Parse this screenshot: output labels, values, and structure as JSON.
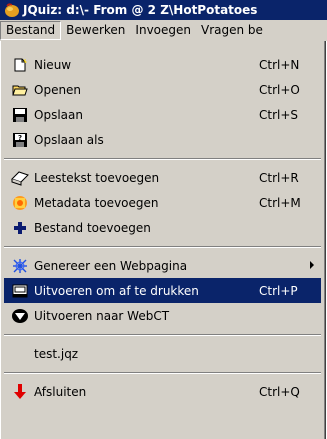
{
  "window": {
    "title": "JQuiz: d:\\- From @ 2 Z\\HotPotatoes"
  },
  "menubar": {
    "items": [
      {
        "label": "Bestand"
      },
      {
        "label": "Bewerken"
      },
      {
        "label": "Invoegen"
      },
      {
        "label": "Vragen be"
      }
    ]
  },
  "dropdown": {
    "items": [
      {
        "label": "Nieuw",
        "shortcut": "Ctrl+N",
        "icon": "new-file-icon"
      },
      {
        "label": "Openen",
        "shortcut": "Ctrl+O",
        "icon": "open-folder-icon"
      },
      {
        "label": "Opslaan",
        "shortcut": "Ctrl+S",
        "icon": "save-disk-icon"
      },
      {
        "label": "Opslaan als",
        "shortcut": "",
        "icon": "save-as-icon"
      },
      {
        "label": "Leestekst toevoegen",
        "shortcut": "Ctrl+R",
        "icon": "reading-text-icon"
      },
      {
        "label": "Metadata toevoegen",
        "shortcut": "Ctrl+M",
        "icon": "metadata-icon"
      },
      {
        "label": "Bestand toevoegen",
        "shortcut": "",
        "icon": "add-file-icon"
      },
      {
        "label": "Genereer een Webpagina",
        "shortcut": "",
        "icon": "web-page-icon"
      },
      {
        "label": "Uitvoeren om af te drukken",
        "shortcut": "Ctrl+P",
        "icon": "print-icon",
        "selected": true
      },
      {
        "label": "Uitvoeren naar WebCT",
        "shortcut": "",
        "icon": "webct-icon"
      },
      {
        "label": "test.jqz",
        "shortcut": ""
      },
      {
        "label": "Afsluiten",
        "shortcut": "Ctrl+Q",
        "icon": "exit-icon"
      }
    ]
  }
}
